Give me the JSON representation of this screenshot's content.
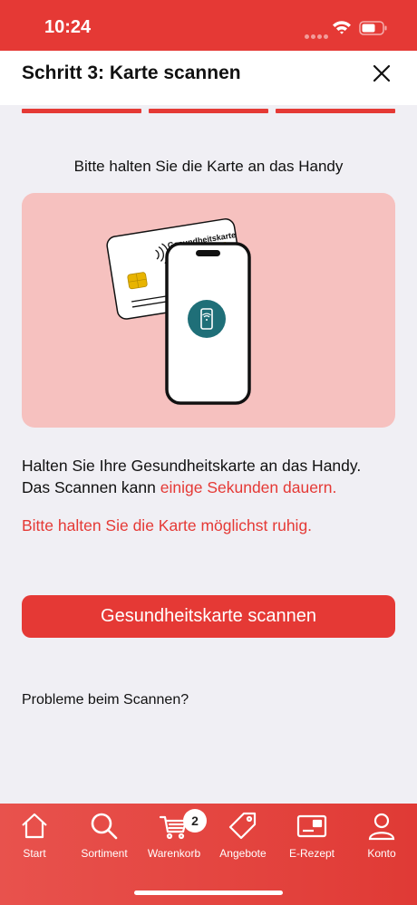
{
  "status_bar": {
    "time": "10:24"
  },
  "header": {
    "title": "Schritt 3: Karte scannen"
  },
  "progress": {
    "steps_total": 3,
    "steps_completed": 3
  },
  "instruction": {
    "title": "Bitte halten Sie die Karte an das Handy"
  },
  "illustration": {
    "card_label": "Gesundheitskarte"
  },
  "body": {
    "line1": "Halten Sie Ihre Gesundheitskarte an das Handy.",
    "line2_prefix": "Das Scannen kann ",
    "line2_highlight": "einige Sekunden dauern.",
    "warning": "Bitte halten Sie die Karte möglichst ruhig."
  },
  "actions": {
    "scan_label": "Gesundheitskarte scannen",
    "help_label": "Probleme beim Scannen?"
  },
  "tab_bar": {
    "items": [
      {
        "label": "Start",
        "icon": "home-icon"
      },
      {
        "label": "Sortiment",
        "icon": "search-icon"
      },
      {
        "label": "Warenkorb",
        "icon": "cart-icon"
      },
      {
        "label": "Angebote",
        "icon": "tag-icon"
      },
      {
        "label": "E-Rezept",
        "icon": "prescription-card-icon"
      },
      {
        "label": "Konto",
        "icon": "user-icon"
      }
    ],
    "cart_count": "2"
  },
  "colors": {
    "accent": "#e53935",
    "illustration_bg": "#f6c1bf",
    "page_bg": "#f0eff4",
    "nfc_teal": "#1f6f78"
  }
}
